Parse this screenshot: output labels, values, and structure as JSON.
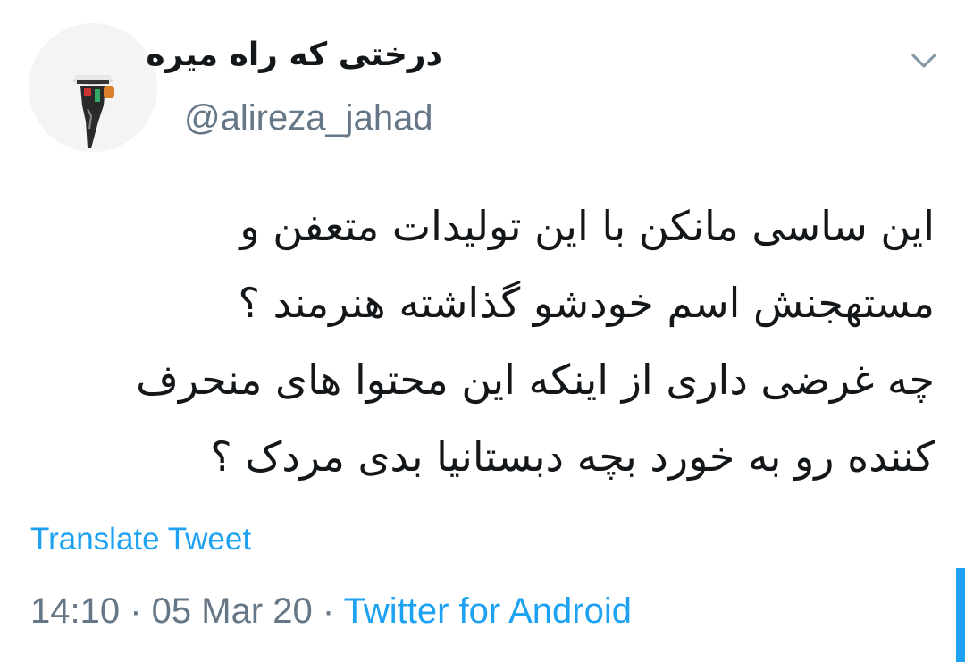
{
  "tweet": {
    "author": {
      "display_name": "درختی که راه میره",
      "handle": "@alireza_jahad",
      "avatar_icon": "profile-photo-avatar"
    },
    "menu_icon": "chevron-down-icon",
    "text_lines": [
      "این ساسی مانکن با این تولیدات متعفن و",
      "مستهجنش اسم خودشو گذاشته هنرمند ؟",
      "چه غرضی داری از اینکه این محتوا های منحرف",
      "کننده رو به خورد بچه دبستانیا بدی مردک ؟"
    ],
    "translate_label": "Translate Tweet",
    "time": "14:10",
    "separator": " · ",
    "date": "05 Mar 20",
    "source": "Twitter for Android"
  },
  "colors": {
    "link": "#1da1f2",
    "secondary_text": "#657786",
    "primary_text": "#14171a",
    "background": "#ffffff"
  }
}
